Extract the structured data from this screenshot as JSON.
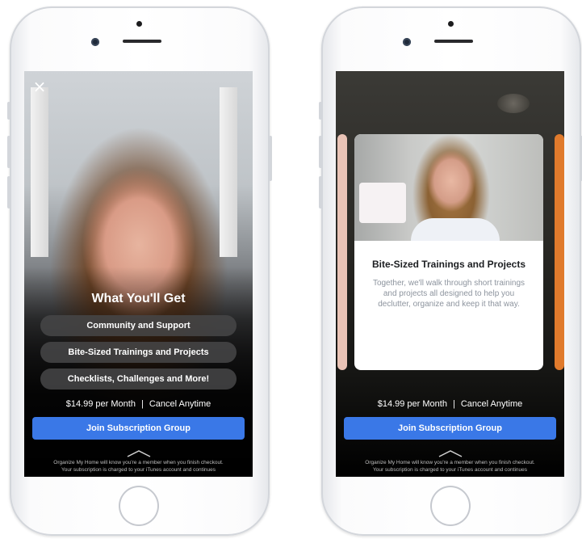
{
  "left_screen": {
    "close_label": "×",
    "heading": "What You'll Get",
    "features": [
      "Community and Support",
      "Bite-Sized Trainings and Projects",
      "Checklists, Challenges and More!"
    ],
    "price": "$14.99 per Month",
    "separator": "|",
    "cancel": "Cancel Anytime",
    "join_button": "Join Subscription Group",
    "fine_print_1": "Organize My Home will know you're a member when you finish checkout.",
    "fine_print_2": "Your subscription is charged to your iTunes account and continues"
  },
  "right_screen": {
    "card_title": "Bite-Sized Trainings and Projects",
    "card_description": "Together, we'll walk through short trainings and projects all designed to help you declutter, organize and keep it that way.",
    "price": "$14.99 per Month",
    "separator": "|",
    "cancel": "Cancel Anytime",
    "join_button": "Join Subscription Group",
    "fine_print_1": "Organize My Home will know you're a member when you finish checkout.",
    "fine_print_2": "Your subscription is charged to your iTunes account and continues"
  },
  "colors": {
    "accent": "#3a78e7",
    "pill": "#464648",
    "peek_left": "#e9c3b6",
    "peek_right": "#e07a2c"
  }
}
